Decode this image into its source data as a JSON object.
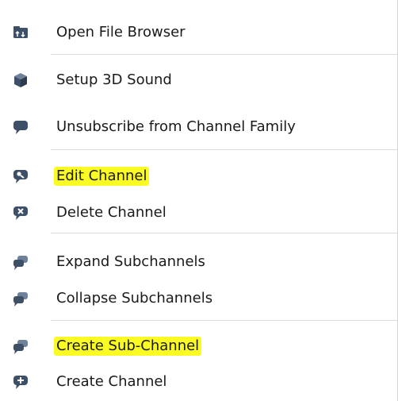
{
  "menu": {
    "items": [
      {
        "label": "Open File Browser",
        "icon": "file-browser-icon",
        "highlighted": false
      },
      {
        "label": "Setup 3D Sound",
        "icon": "cube-icon",
        "highlighted": false
      },
      {
        "label": "Unsubscribe from Channel Family",
        "icon": "speech-bubble-icon",
        "highlighted": false
      },
      {
        "label": "Edit Channel",
        "icon": "edit-bubble-icon",
        "highlighted": true
      },
      {
        "label": "Delete Channel",
        "icon": "delete-bubble-icon",
        "highlighted": false
      },
      {
        "label": "Expand Subchannels",
        "icon": "subchannel-bubble-icon",
        "highlighted": false
      },
      {
        "label": "Collapse Subchannels",
        "icon": "subchannel-bubble-icon",
        "highlighted": false
      },
      {
        "label": "Create Sub-Channel",
        "icon": "subchannel-bubble-icon",
        "highlighted": true
      },
      {
        "label": "Create Channel",
        "icon": "add-bubble-icon",
        "highlighted": false
      }
    ],
    "colors": {
      "icon": "#3d5068",
      "highlight": "#fbfb24",
      "text": "#1a1a1a",
      "separator": "#dcdcdc"
    }
  }
}
